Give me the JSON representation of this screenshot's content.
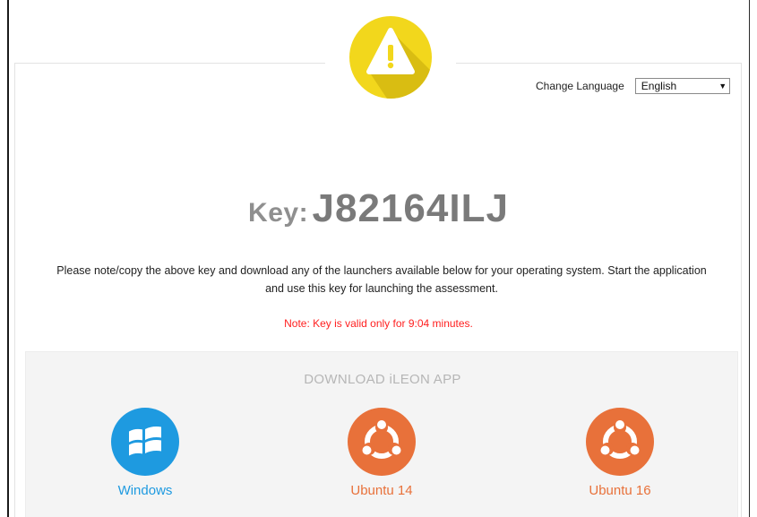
{
  "language": {
    "label": "Change Language",
    "selected": "English"
  },
  "key": {
    "label": "Key:",
    "value": "J82164ILJ"
  },
  "instructions": "Please note/copy the above key and download any of the launchers available below for your operating system. Start the application and use this key for launching the assessment.",
  "note": "Note: Key is valid only for 9:04 minutes.",
  "download": {
    "title": "DOWNLOAD iLEON APP",
    "apps": [
      {
        "label": "Windows",
        "icon": "windows-icon"
      },
      {
        "label": "Ubuntu 14",
        "icon": "ubuntu-icon"
      },
      {
        "label": "Ubuntu 16",
        "icon": "ubuntu-icon"
      }
    ]
  },
  "colors": {
    "warning_yellow": "#f2d71c",
    "note_red": "#ff1f1f",
    "windows_blue": "#1e9ae0",
    "ubuntu_orange": "#e8713a",
    "key_gray": "#7a7a7a"
  }
}
